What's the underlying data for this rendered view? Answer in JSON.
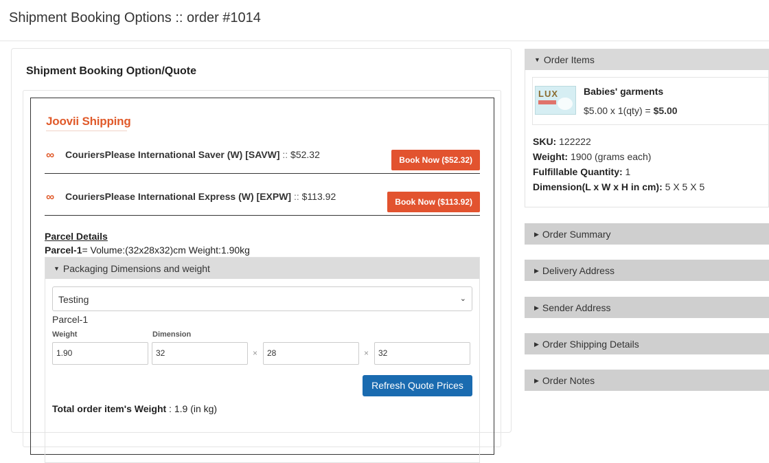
{
  "header": {
    "title": "Shipment Booking Options :: order #1014"
  },
  "left": {
    "card_title": "Shipment Booking Option/Quote",
    "carrier_name": "Joovii Shipping",
    "services": [
      {
        "icon": "infinity-icon",
        "name": "CouriersPlease International Saver (W) [SAVW]",
        "sep": " :: ",
        "price": "$52.32",
        "button": "Book Now ($52.32)"
      },
      {
        "icon": "infinity-icon",
        "name": "CouriersPlease International Express (W) [EXPW]",
        "sep": " :: ",
        "price": "$113.92",
        "button": "Book Now ($113.92)"
      }
    ],
    "parcel_details_title": "Parcel Details",
    "parcel_line_label": "Parcel-1",
    "parcel_line_text": "= Volume:(32x28x32)cm Weight:1.90kg",
    "packaging": {
      "header": "Packaging Dimensions and weight",
      "select_value": "Testing",
      "parcel_label": "Parcel-1",
      "weight_label": "Weight",
      "dimension_label": "Dimension",
      "weight": "1.90",
      "dim_l": "32",
      "dim_w": "28",
      "dim_h": "32",
      "times": "×",
      "refresh_button": "Refresh Quote Prices",
      "total_label": "Total order item's Weight",
      "total_value": " : 1.9 (in kg)"
    }
  },
  "right": {
    "order_items": {
      "title": "Order Items",
      "item_name": "Babies' garments",
      "item_price_prefix": "$5.00 x 1(qty) = ",
      "item_price_total": "$5.00",
      "thumb_text": "LUX",
      "sku_label": "SKU:",
      "sku": " 122222",
      "weight_label": "Weight:",
      "weight": " 1900 (grams each)",
      "qty_label": "Fulfillable Quantity:",
      "qty": " 1",
      "dim_label": "Dimension(L x W x H in cm):",
      "dim": " 5 X 5 X 5"
    },
    "sections": [
      {
        "title": "Order Summary"
      },
      {
        "title": "Delivery Address"
      },
      {
        "title": "Sender Address"
      },
      {
        "title": "Order Shipping Details"
      },
      {
        "title": "Order Notes"
      }
    ]
  },
  "colors": {
    "brand": "#e05a2a",
    "book_button": "#e2532f",
    "refresh_button": "#1a6bb0",
    "accordion": "#cfcfcf"
  }
}
